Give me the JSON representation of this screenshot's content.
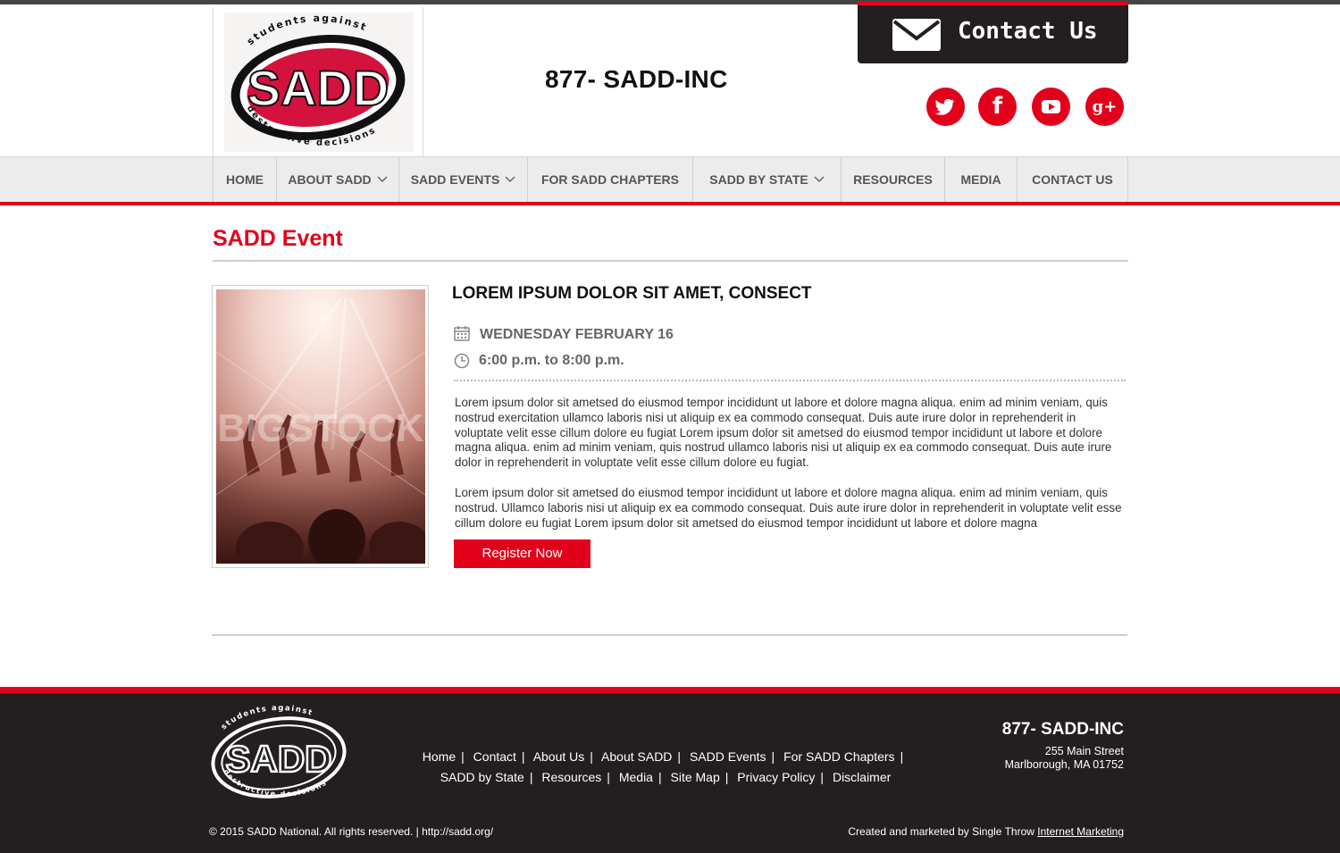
{
  "header": {
    "phone": "877- SADD-INC",
    "logo": {
      "main": "SADD",
      "arc_top": "students against",
      "arc_bottom": "destructive decisions"
    },
    "contact_button": "Contact Us",
    "social": [
      {
        "name": "twitter",
        "glyph": "t"
      },
      {
        "name": "facebook",
        "glyph": "f"
      },
      {
        "name": "youtube",
        "glyph": "▶"
      },
      {
        "name": "google-plus",
        "glyph": "g+"
      }
    ]
  },
  "nav": {
    "items": [
      {
        "label": "HOME",
        "dropdown": false
      },
      {
        "label": "ABOUT SADD",
        "dropdown": true
      },
      {
        "label": "SADD EVENTS",
        "dropdown": true
      },
      {
        "label": "FOR SADD CHAPTERS",
        "dropdown": false
      },
      {
        "label": "SADD BY STATE",
        "dropdown": true
      },
      {
        "label": "RESOURCES",
        "dropdown": false
      },
      {
        "label": "MEDIA",
        "dropdown": false
      },
      {
        "label": "CONTACT US",
        "dropdown": false
      }
    ]
  },
  "main": {
    "title": "SADD Event",
    "event": {
      "title": "LOREM IPSUM DOLOR SIT AMET, CONSECT",
      "date": "WEDNESDAY FEBRUARY 16",
      "time": "6:00 p.m. to 8:00 p.m.",
      "paragraph1": "Lorem ipsum dolor sit ametsed do eiusmod tempor incididunt ut labore et dolore magna aliqua. enim ad minim veniam, quis nostrud exercitation ullamco laboris nisi ut aliquip ex ea commodo consequat. Duis aute irure dolor in reprehenderit in voluptate velit esse cillum dolore eu fugiat Lorem ipsum dolor sit ametsed do eiusmod tempor incididunt ut labore et dolore magna aliqua.  enim ad minim veniam, quis nostrud  ullamco laboris nisi ut aliquip ex ea commodo consequat. Duis aute irure dolor in reprehenderit in voluptate velit esse cillum dolore eu fugiat.",
      "paragraph2": "Lorem ipsum dolor sit ametsed do eiusmod tempor incididunt ut labore et dolore magna aliqua.  enim ad minim veniam, quis nostrud. Ullamco laboris nisi ut aliquip ex ea commodo consequat. Duis aute irure dolor in reprehenderit in voluptate velit esse cillum dolore eu fugiat Lorem ipsum dolor sit ametsed do eiusmod tempor incididunt ut labore et dolore magna",
      "register_button": "Register Now",
      "image_watermark": "BIGSTOCK"
    }
  },
  "footer": {
    "links_row1": [
      "Home",
      "Contact",
      "About Us",
      "About SADD",
      "SADD Events",
      "For SADD Chapters"
    ],
    "links_row2": [
      "SADD by State",
      "Resources",
      "Media",
      "Site Map",
      "Privacy Policy",
      "Disclaimer"
    ],
    "phone": "877- SADD-INC",
    "address_line1": "255 Main Street",
    "address_line2": "Marlborough, MA 01752",
    "copyright": "© 2015 SADD National. All rights reserved. | http://sadd.org/",
    "credit_prefix": "Created and marketed by Single Throw ",
    "credit_link": "Internet Marketing"
  },
  "colors": {
    "accent": "#e3001b",
    "dark": "#231f20",
    "nav_bg": "#ececec"
  }
}
